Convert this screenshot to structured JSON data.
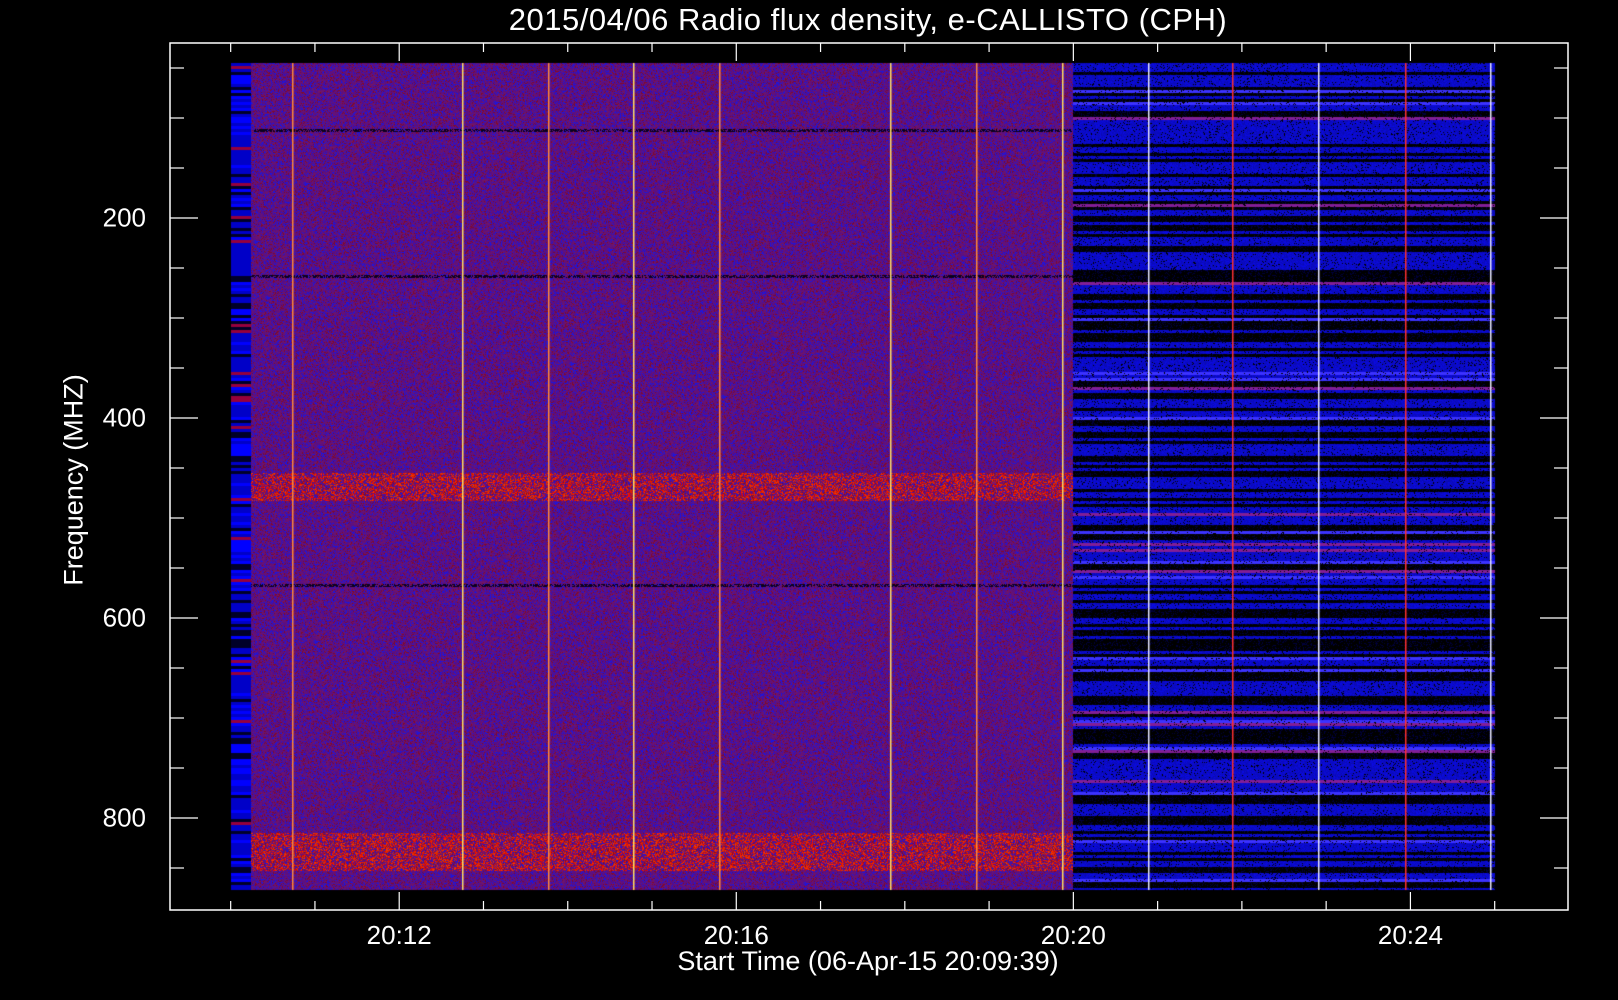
{
  "chart_data": {
    "type": "heatmap",
    "title": "2015/04/06  Radio flux density, e-CALLISTO (CPH)",
    "xlabel": "Start Time (06-Apr-15 20:09:39)",
    "ylabel": "Frequency (MHZ)",
    "x_unit": "minutes after 20:00",
    "xlim": [
      9.28,
      25.87
    ],
    "data_xrange": [
      10.0,
      25.0
    ],
    "xticks": [
      {
        "value": 12,
        "label": "20:12"
      },
      {
        "value": 16,
        "label": "20:16"
      },
      {
        "value": 20,
        "label": "20:20"
      },
      {
        "value": 24,
        "label": "20:24"
      }
    ],
    "x_minor_step": 1,
    "ylim": [
      892,
      25
    ],
    "data_yrange": [
      45,
      872
    ],
    "yticks": [
      {
        "value": 200,
        "label": "200"
      },
      {
        "value": 400,
        "label": "400"
      },
      {
        "value": 600,
        "label": "600"
      },
      {
        "value": 800,
        "label": "800"
      }
    ],
    "y_minor_step": 50,
    "segments": [
      {
        "from": 10.0,
        "to": 20.0,
        "style": "background-subtracted, purple noise"
      },
      {
        "from": 20.0,
        "to": 25.0,
        "style": "dark, blue horizontal bands"
      }
    ],
    "bright_bands_mhz": [
      [
        455,
        482
      ],
      [
        815,
        852
      ]
    ],
    "interference_lines_min": [
      10.73,
      12.75,
      13.77,
      14.78,
      15.8,
      17.82,
      18.84,
      19.86,
      20.88,
      21.88,
      22.9,
      23.93,
      24.94
    ],
    "colors": {
      "background": "#000000",
      "axis": "#ffffff"
    }
  }
}
